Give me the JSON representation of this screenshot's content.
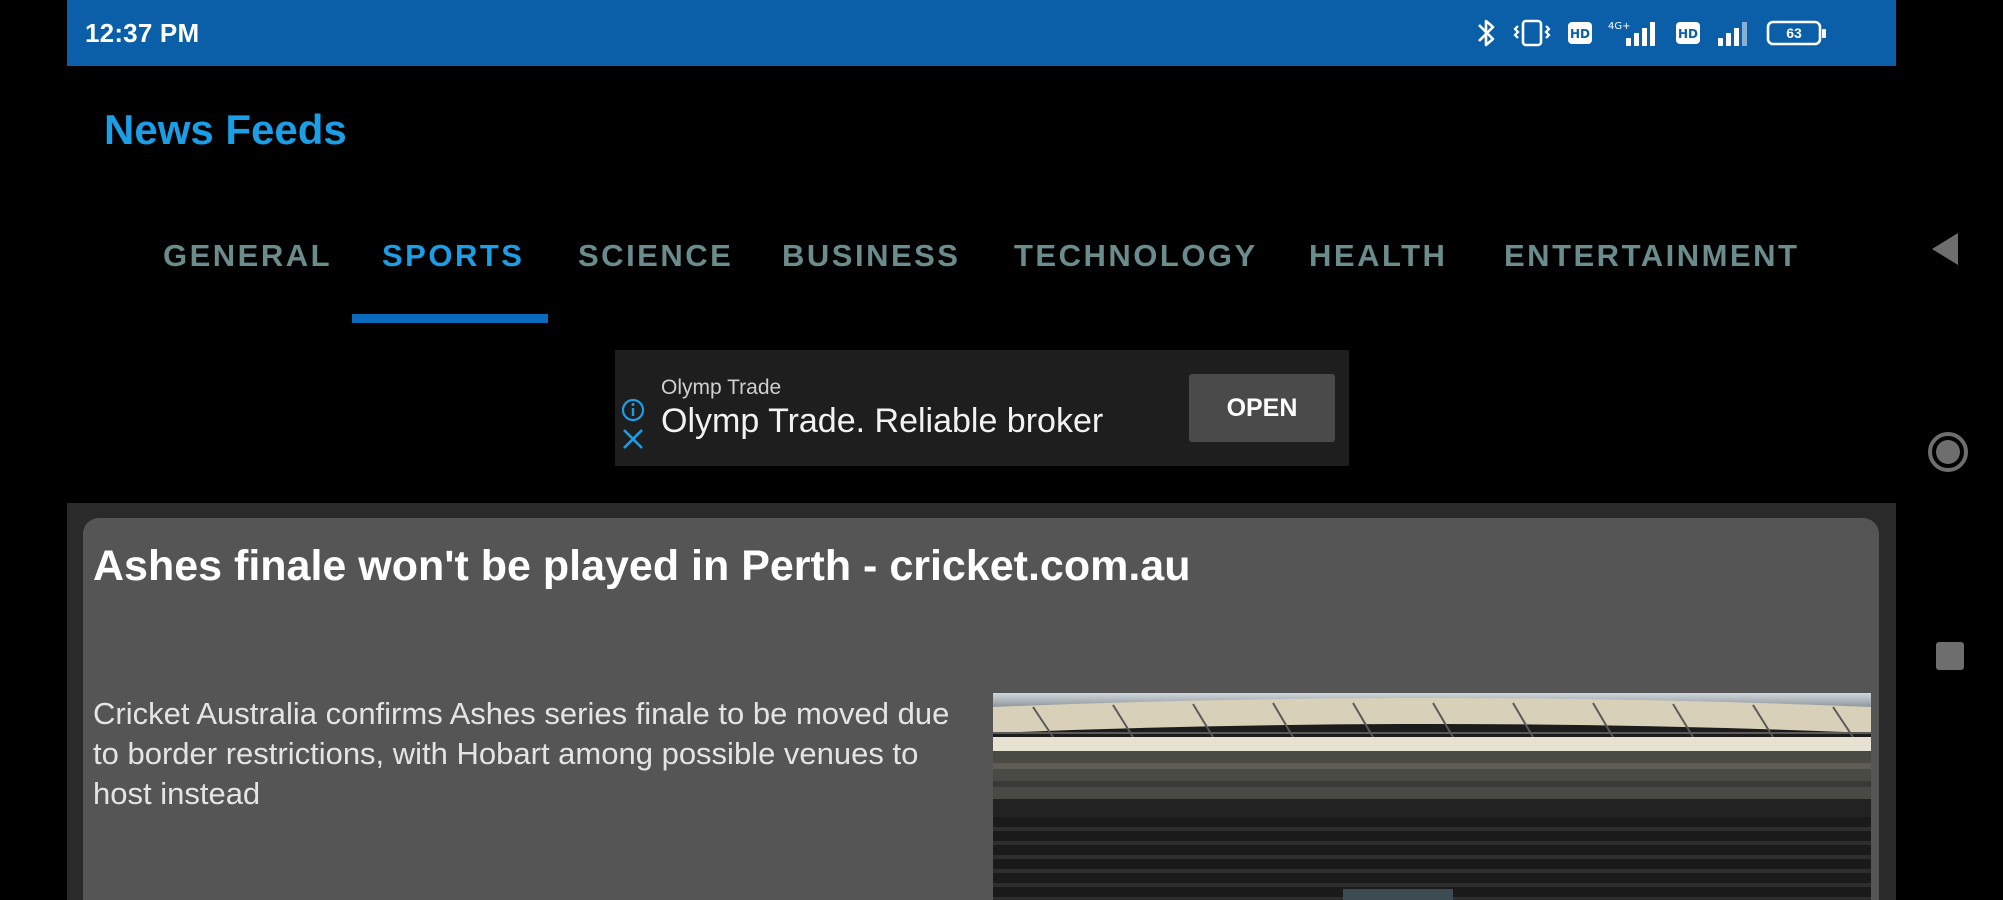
{
  "status_bar": {
    "time": "12:37 PM",
    "battery": "63"
  },
  "app": {
    "title": "News Feeds"
  },
  "tabs": [
    {
      "label": "GENERAL",
      "active": false
    },
    {
      "label": "SPORTS",
      "active": true
    },
    {
      "label": "SCIENCE",
      "active": false
    },
    {
      "label": "BUSINESS",
      "active": false
    },
    {
      "label": "TECHNOLOGY",
      "active": false
    },
    {
      "label": "HEALTH",
      "active": false
    },
    {
      "label": "ENTERTAINMENT",
      "active": false
    }
  ],
  "ad": {
    "sponsor": "Olymp Trade",
    "headline": "Olymp Trade. Reliable broker",
    "cta": "OPEN"
  },
  "articles": [
    {
      "title": "Ashes finale won't be played in Perth - cricket.com.au",
      "description": "Cricket Australia confirms Ashes series finale to be moved due to border restrictions, with Hobart among possible venues to host instead"
    }
  ],
  "colors": {
    "status_bar": "#0a5fa8",
    "accent": "#1a9ee6",
    "tab_inactive": "#6b8c8c",
    "card_bg": "#555555"
  }
}
